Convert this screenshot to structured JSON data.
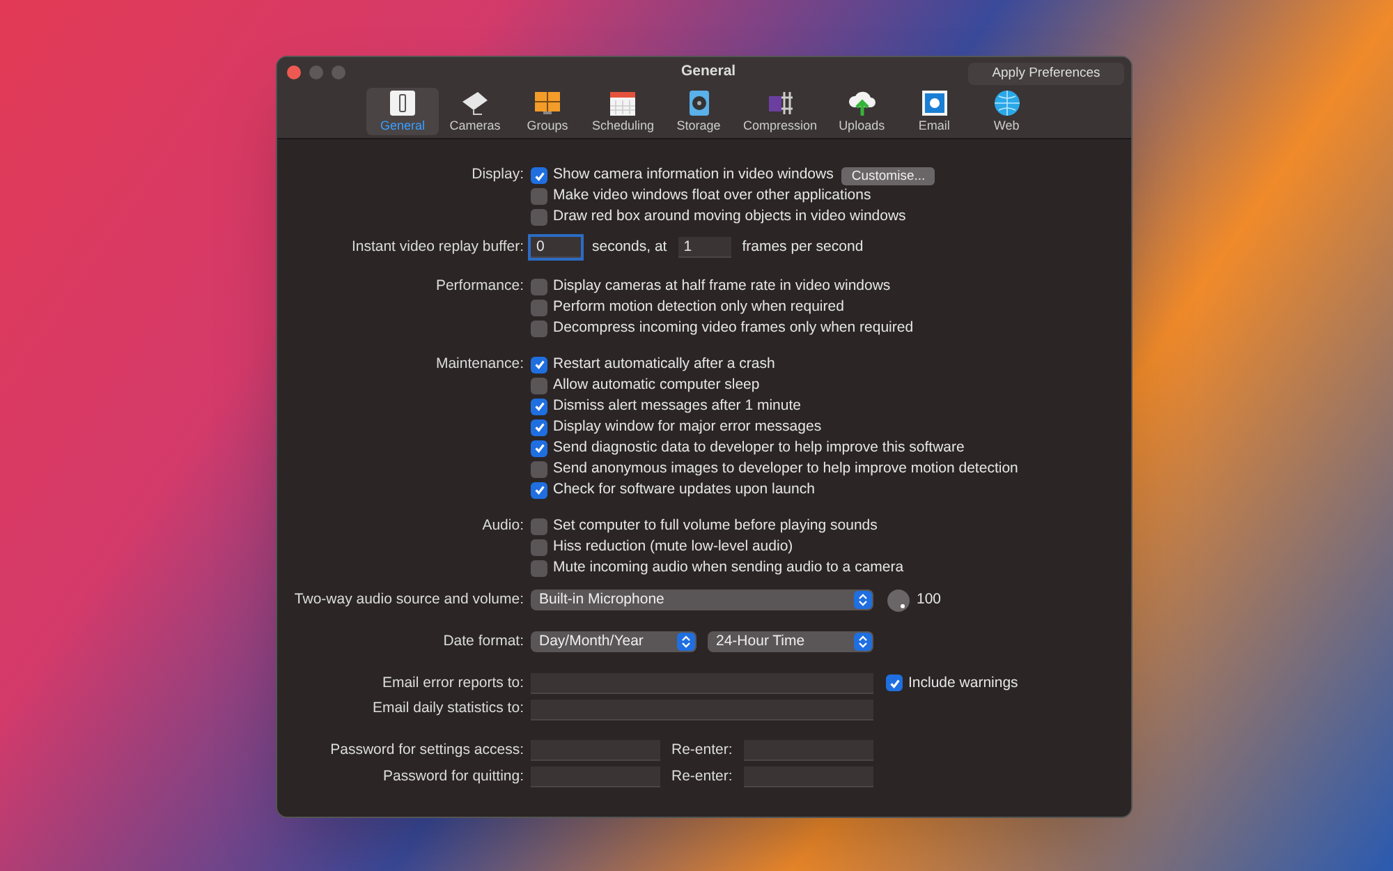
{
  "window": {
    "title": "General",
    "apply_button": "Apply Preferences"
  },
  "tabs": [
    {
      "label": "General",
      "selected": true
    },
    {
      "label": "Cameras",
      "selected": false
    },
    {
      "label": "Groups",
      "selected": false
    },
    {
      "label": "Scheduling",
      "selected": false
    },
    {
      "label": "Storage",
      "selected": false
    },
    {
      "label": "Compression",
      "selected": false
    },
    {
      "label": "Uploads",
      "selected": false
    },
    {
      "label": "Email",
      "selected": false
    },
    {
      "label": "Web",
      "selected": false
    }
  ],
  "sections": [
    [
      {
        "kind": "checks",
        "label": "Display:",
        "items": [
          {
            "label": "Show camera information in video windows",
            "checked": true,
            "button": "Customise..."
          },
          {
            "label": "Make video windows float over other applications",
            "checked": false
          },
          {
            "label": "Draw red box around moving objects in video windows",
            "checked": false
          }
        ]
      },
      {
        "kind": "replay",
        "label": "Instant video replay buffer:",
        "seconds_value": "0",
        "seconds_text": "seconds, at",
        "fps_value": "1",
        "fps_text": "frames per second"
      }
    ],
    [
      {
        "kind": "checks",
        "label": "Performance:",
        "items": [
          {
            "label": "Display cameras at half frame rate in video windows",
            "checked": false
          },
          {
            "label": "Perform motion detection only when required",
            "checked": false
          },
          {
            "label": "Decompress incoming video frames only when required",
            "checked": false
          }
        ]
      }
    ],
    [
      {
        "kind": "checks",
        "label": "Maintenance:",
        "items": [
          {
            "label": "Restart automatically after a crash",
            "checked": true
          },
          {
            "label": "Allow automatic computer sleep",
            "checked": false
          },
          {
            "label": "Dismiss alert messages after 1 minute",
            "checked": true
          },
          {
            "label": "Display window for major error messages",
            "checked": true
          },
          {
            "label": "Send diagnostic data to developer to help improve this software",
            "checked": true
          },
          {
            "label": "Send anonymous images to developer to help improve motion detection",
            "checked": false
          },
          {
            "label": "Check for software updates upon launch",
            "checked": true
          }
        ]
      }
    ],
    [
      {
        "kind": "checks",
        "label": "Audio:",
        "items": [
          {
            "label": "Set computer to full volume before playing sounds",
            "checked": false
          },
          {
            "label": "Hiss reduction (mute low-level audio)",
            "checked": false
          },
          {
            "label": "Mute incoming audio when sending audio to a camera",
            "checked": false
          }
        ]
      },
      {
        "kind": "source",
        "label": "Two-way audio source and volume:",
        "value": "Built-in Microphone",
        "volume": "100"
      }
    ],
    [
      {
        "kind": "date",
        "label": "Date format:",
        "selects": [
          "Day/Month/Year",
          "24-Hour Time"
        ]
      }
    ],
    [
      {
        "kind": "email",
        "label": "Email error reports to:",
        "check": {
          "label": "Include warnings",
          "checked": true
        }
      },
      {
        "kind": "email",
        "label": "Email daily statistics to:"
      }
    ],
    [
      {
        "kind": "password",
        "label": "Password for settings access:",
        "reenter": "Re-enter:"
      },
      {
        "kind": "password",
        "label": "Password for quitting:",
        "reenter": "Re-enter:"
      }
    ]
  ]
}
